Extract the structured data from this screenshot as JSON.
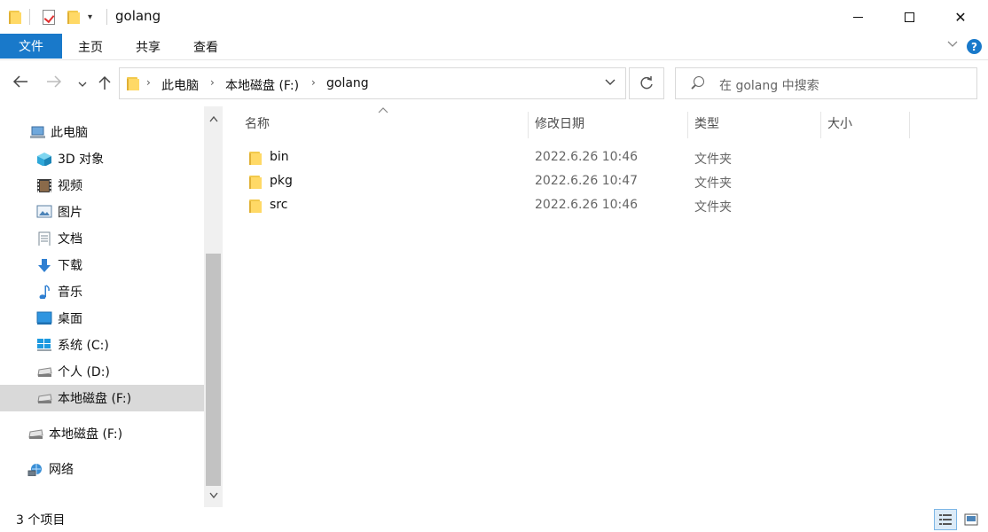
{
  "window": {
    "title": "golang",
    "controls": {
      "minimize": "minimize",
      "maximize": "maximize",
      "close": "✕"
    }
  },
  "ribbon": {
    "tabs": [
      {
        "label": "文件",
        "active": true
      },
      {
        "label": "主页"
      },
      {
        "label": "共享"
      },
      {
        "label": "查看"
      }
    ],
    "expand_icon": "chevron-down-icon",
    "help": "?"
  },
  "address": {
    "crumbs": [
      "此电脑",
      "本地磁盘 (F:)",
      "golang"
    ],
    "search_placeholder": "在 golang 中搜索"
  },
  "nav_pane": {
    "items": [
      {
        "label": "此电脑",
        "icon": "computer-icon"
      },
      {
        "label": "3D 对象",
        "icon": "cube-icon"
      },
      {
        "label": "视频",
        "icon": "video-icon"
      },
      {
        "label": "图片",
        "icon": "picture-icon"
      },
      {
        "label": "文档",
        "icon": "document-icon"
      },
      {
        "label": "下载",
        "icon": "download-icon"
      },
      {
        "label": "音乐",
        "icon": "music-icon"
      },
      {
        "label": "桌面",
        "icon": "desktop-icon"
      },
      {
        "label": "系统 (C:)",
        "icon": "windows-drive-icon"
      },
      {
        "label": "个人 (D:)",
        "icon": "drive-icon"
      },
      {
        "label": "本地磁盘 (F:)",
        "icon": "drive-icon",
        "selected": true
      },
      {
        "label": "本地磁盘 (F:)",
        "icon": "drive-icon"
      },
      {
        "label": "网络",
        "icon": "network-icon"
      }
    ]
  },
  "columns": {
    "name": "名称",
    "date": "修改日期",
    "type": "类型",
    "size": "大小"
  },
  "files": [
    {
      "name": "bin",
      "date": "2022.6.26 10:46",
      "type": "文件夹"
    },
    {
      "name": "pkg",
      "date": "2022.6.26 10:47",
      "type": "文件夹"
    },
    {
      "name": "src",
      "date": "2022.6.26 10:46",
      "type": "文件夹"
    }
  ],
  "status": {
    "item_count": "3 个项目"
  },
  "colors": {
    "accent": "#1979ca",
    "folder": "#ffd966",
    "selected_nav": "#d9d9d9"
  }
}
